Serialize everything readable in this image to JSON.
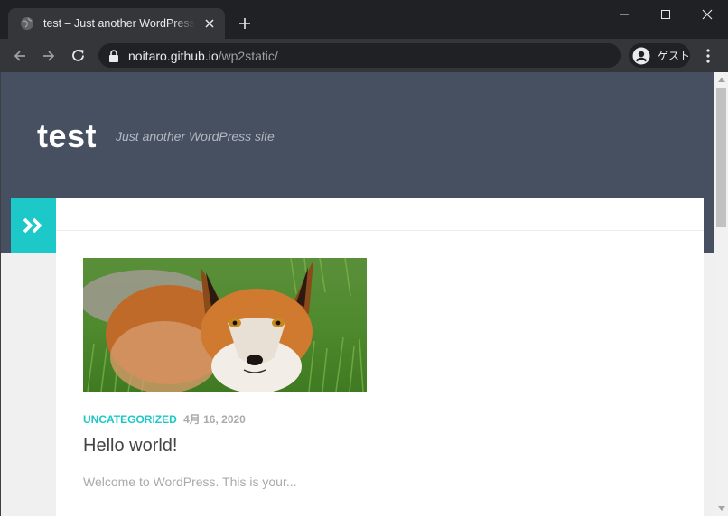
{
  "browser": {
    "tab_title": "test – Just another WordPress site",
    "url_host": "noitaro.github.io",
    "url_path": "/wp2static/",
    "profile_label": "ゲスト"
  },
  "site": {
    "title": "test",
    "tagline": "Just another WordPress site"
  },
  "post": {
    "category": "UNCATEGORIZED",
    "date": "4月 16, 2020",
    "title": "Hello world!",
    "excerpt": "Welcome to WordPress. This is your..."
  },
  "colors": {
    "accent": "#1cc8c8",
    "hero_bg": "#475060",
    "chrome_dark": "#202124",
    "chrome_toolbar": "#35363a"
  }
}
